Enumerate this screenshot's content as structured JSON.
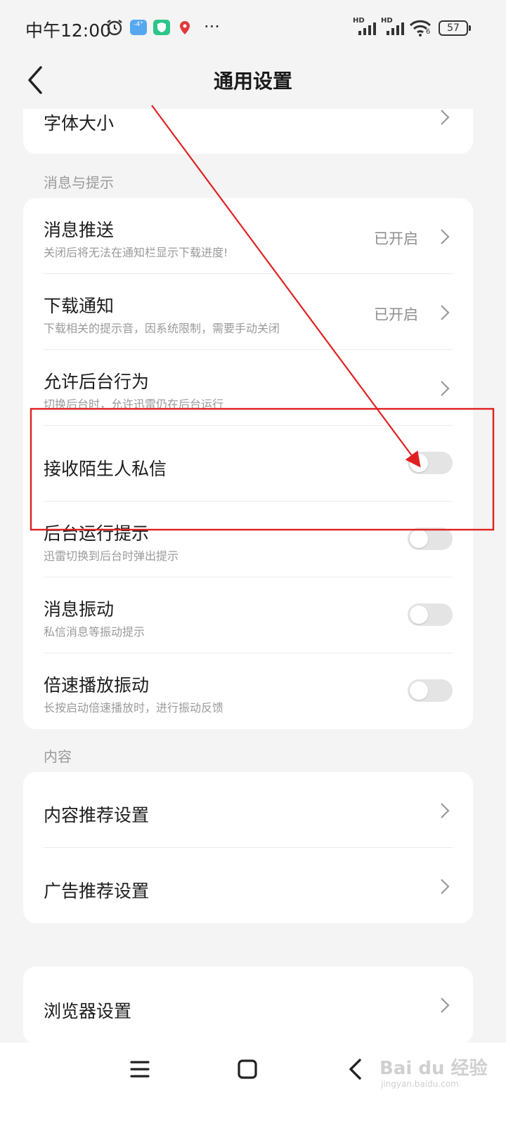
{
  "status_bar": {
    "time": "中午12:00",
    "weather": "-4°",
    "more": "···",
    "signal_label_1": "HD",
    "signal_label_2": "HD",
    "wifi_label": "6",
    "battery": "57"
  },
  "header": {
    "title": "通用设置"
  },
  "top_card": {
    "font_size_label": "字体大小"
  },
  "sections": {
    "messages_title": "消息与提示",
    "content_title": "内容"
  },
  "messages": {
    "push": {
      "label": "消息推送",
      "desc": "关闭后将无法在通知栏显示下载进度!",
      "value": "已开启"
    },
    "download_notice": {
      "label": "下载通知",
      "desc": "下载相关的提示音，因系统限制，需要手动关闭",
      "value": "已开启"
    },
    "background": {
      "label": "允许后台行为",
      "desc": "切换后台时，允许迅雷仍在后台运行"
    },
    "stranger_msg": {
      "label": "接收陌生人私信",
      "on": false
    },
    "bg_tip": {
      "label": "后台运行提示",
      "desc": "迅雷切换到后台时弹出提示",
      "on": false
    },
    "vibrate": {
      "label": "消息振动",
      "desc": "私信消息等振动提示",
      "on": false
    },
    "speed_vibrate": {
      "label": "倍速播放振动",
      "desc": "长按启动倍速播放时，进行振动反馈",
      "on": false
    }
  },
  "content": {
    "recommend": {
      "label": "内容推荐设置"
    },
    "ads": {
      "label": "广告推荐设置"
    }
  },
  "browser": {
    "label": "浏览器设置"
  },
  "watermark": {
    "main": "Bai du 经验",
    "sub": "jingyan.baidu.com"
  },
  "annotation": {
    "color": "#e02020"
  }
}
